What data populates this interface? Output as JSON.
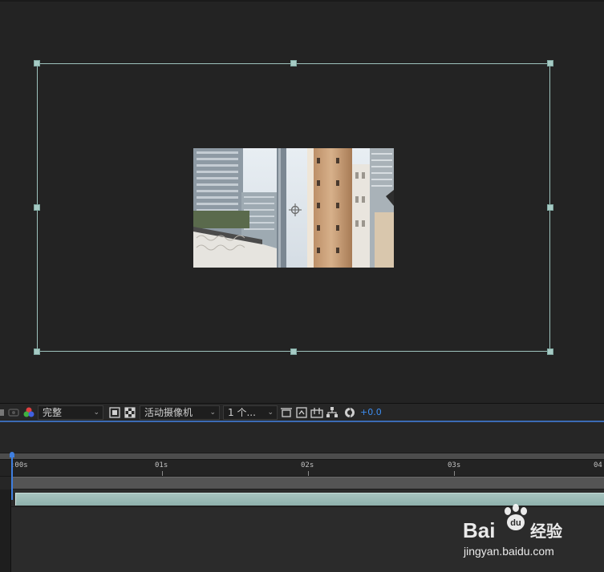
{
  "toolbar": {
    "resolution": {
      "selected": "完整"
    },
    "camera": {
      "selected": "活动摄像机"
    },
    "views": {
      "selected": "1 个..."
    },
    "exposure": "+0.0"
  },
  "timeline": {
    "ruler_labels": [
      ":00s",
      "01s",
      "02s",
      "03s",
      "04"
    ]
  },
  "watermark": {
    "brand": "Bai",
    "brand_suffix": "经验",
    "url": "jingyan.baidu.com"
  },
  "colors": {
    "accent": "#3f7fe0",
    "frame": "#9ec3bd",
    "layer_bar": "#9dbcb8"
  }
}
